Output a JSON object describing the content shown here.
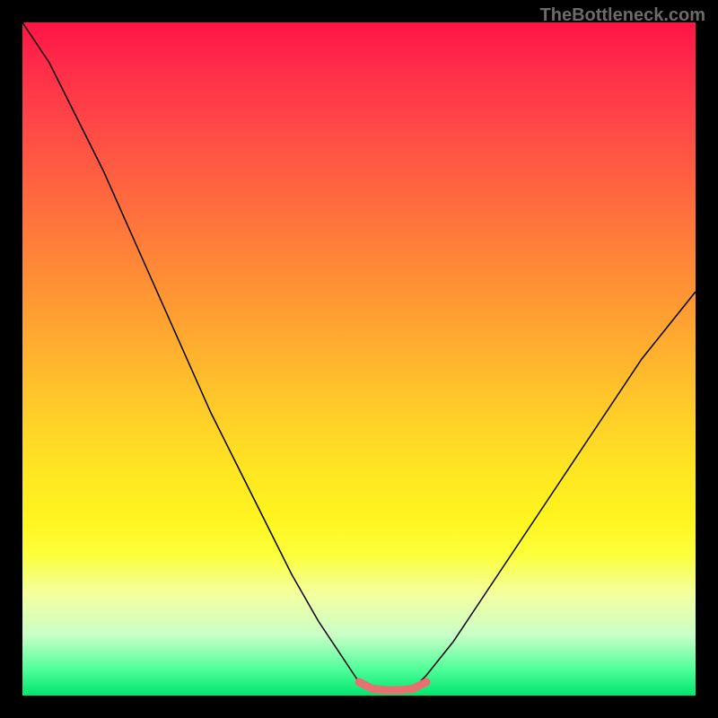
{
  "watermark": "TheBottleneck.com",
  "chart_data": {
    "type": "line",
    "title": "",
    "xlabel": "",
    "ylabel": "",
    "xlim": [
      0,
      100
    ],
    "ylim": [
      0,
      100
    ],
    "grid": false,
    "legend": false,
    "background_gradient": {
      "direction": "vertical",
      "stops": [
        {
          "pos": 0,
          "color": "#ff1446"
        },
        {
          "pos": 50,
          "color": "#ffc72a"
        },
        {
          "pos": 80,
          "color": "#fcff3a"
        },
        {
          "pos": 100,
          "color": "#00e56e"
        }
      ]
    },
    "series": [
      {
        "name": "bottleneck-curve",
        "stroke": "#000000",
        "stroke_width": 1.5,
        "x": [
          0,
          4,
          8,
          12,
          16,
          20,
          24,
          28,
          32,
          36,
          40,
          44,
          48,
          50,
          52,
          56,
          58,
          60,
          64,
          68,
          72,
          76,
          80,
          84,
          88,
          92,
          96,
          100
        ],
        "y": [
          100,
          94,
          86,
          78,
          69,
          60,
          51,
          42,
          34,
          26,
          18,
          11,
          5,
          2,
          1,
          0.5,
          1,
          3,
          8,
          14,
          20,
          26,
          32,
          38,
          44,
          50,
          55,
          60
        ]
      },
      {
        "name": "flat-highlight",
        "stroke": "#e87070",
        "stroke_width": 9,
        "x": [
          50,
          52,
          54,
          56,
          58,
          60
        ],
        "y": [
          2,
          1,
          0.8,
          0.8,
          1,
          2
        ]
      }
    ]
  }
}
